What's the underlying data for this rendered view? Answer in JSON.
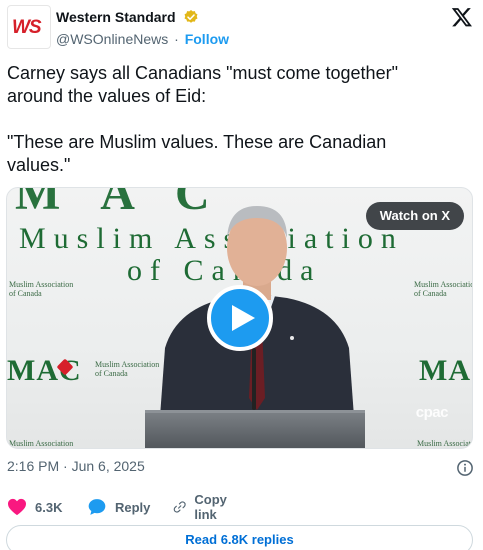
{
  "account": {
    "display_name": "Western Standard",
    "handle": "@WSOnlineNews",
    "separator": "·",
    "follow_label": "Follow",
    "logo_text": "WS",
    "logo_icon": "western-standard-logo"
  },
  "tweet": {
    "paragraphs": [
      "Carney says all Canadians \"must come together\" around the values of Eid:",
      "\"These are Muslim values. These are Canadian values.\""
    ]
  },
  "media": {
    "watch_label": "Watch on X",
    "watermark": "cpac",
    "backdrop": {
      "line1": "Muslim  Association",
      "line2": "of  Canada",
      "mac": "MAC",
      "small_left": "Muslim Association\nof Canada",
      "small_center": "Muslim Association\nof Canada",
      "small_right": "Muslim Association\nof Canada",
      "bottom_left": "Muslim Association",
      "bottom_right": "Muslim Association"
    },
    "play_icon": "play-icon"
  },
  "meta": {
    "timestamp": "2:16 PM · Jun 6, 2025",
    "info_icon": "info-icon"
  },
  "actions": {
    "likes": "6.3K",
    "reply_label": "Reply",
    "copy_label": "Copy link"
  },
  "replies_button": "Read 6.8K replies",
  "colors": {
    "accent": "#1d9bf0",
    "link": "#006fd6",
    "like": "#f91880",
    "verified": "#e2b719",
    "brand_red": "#d6202a",
    "mac_green": "#1e6b34"
  }
}
